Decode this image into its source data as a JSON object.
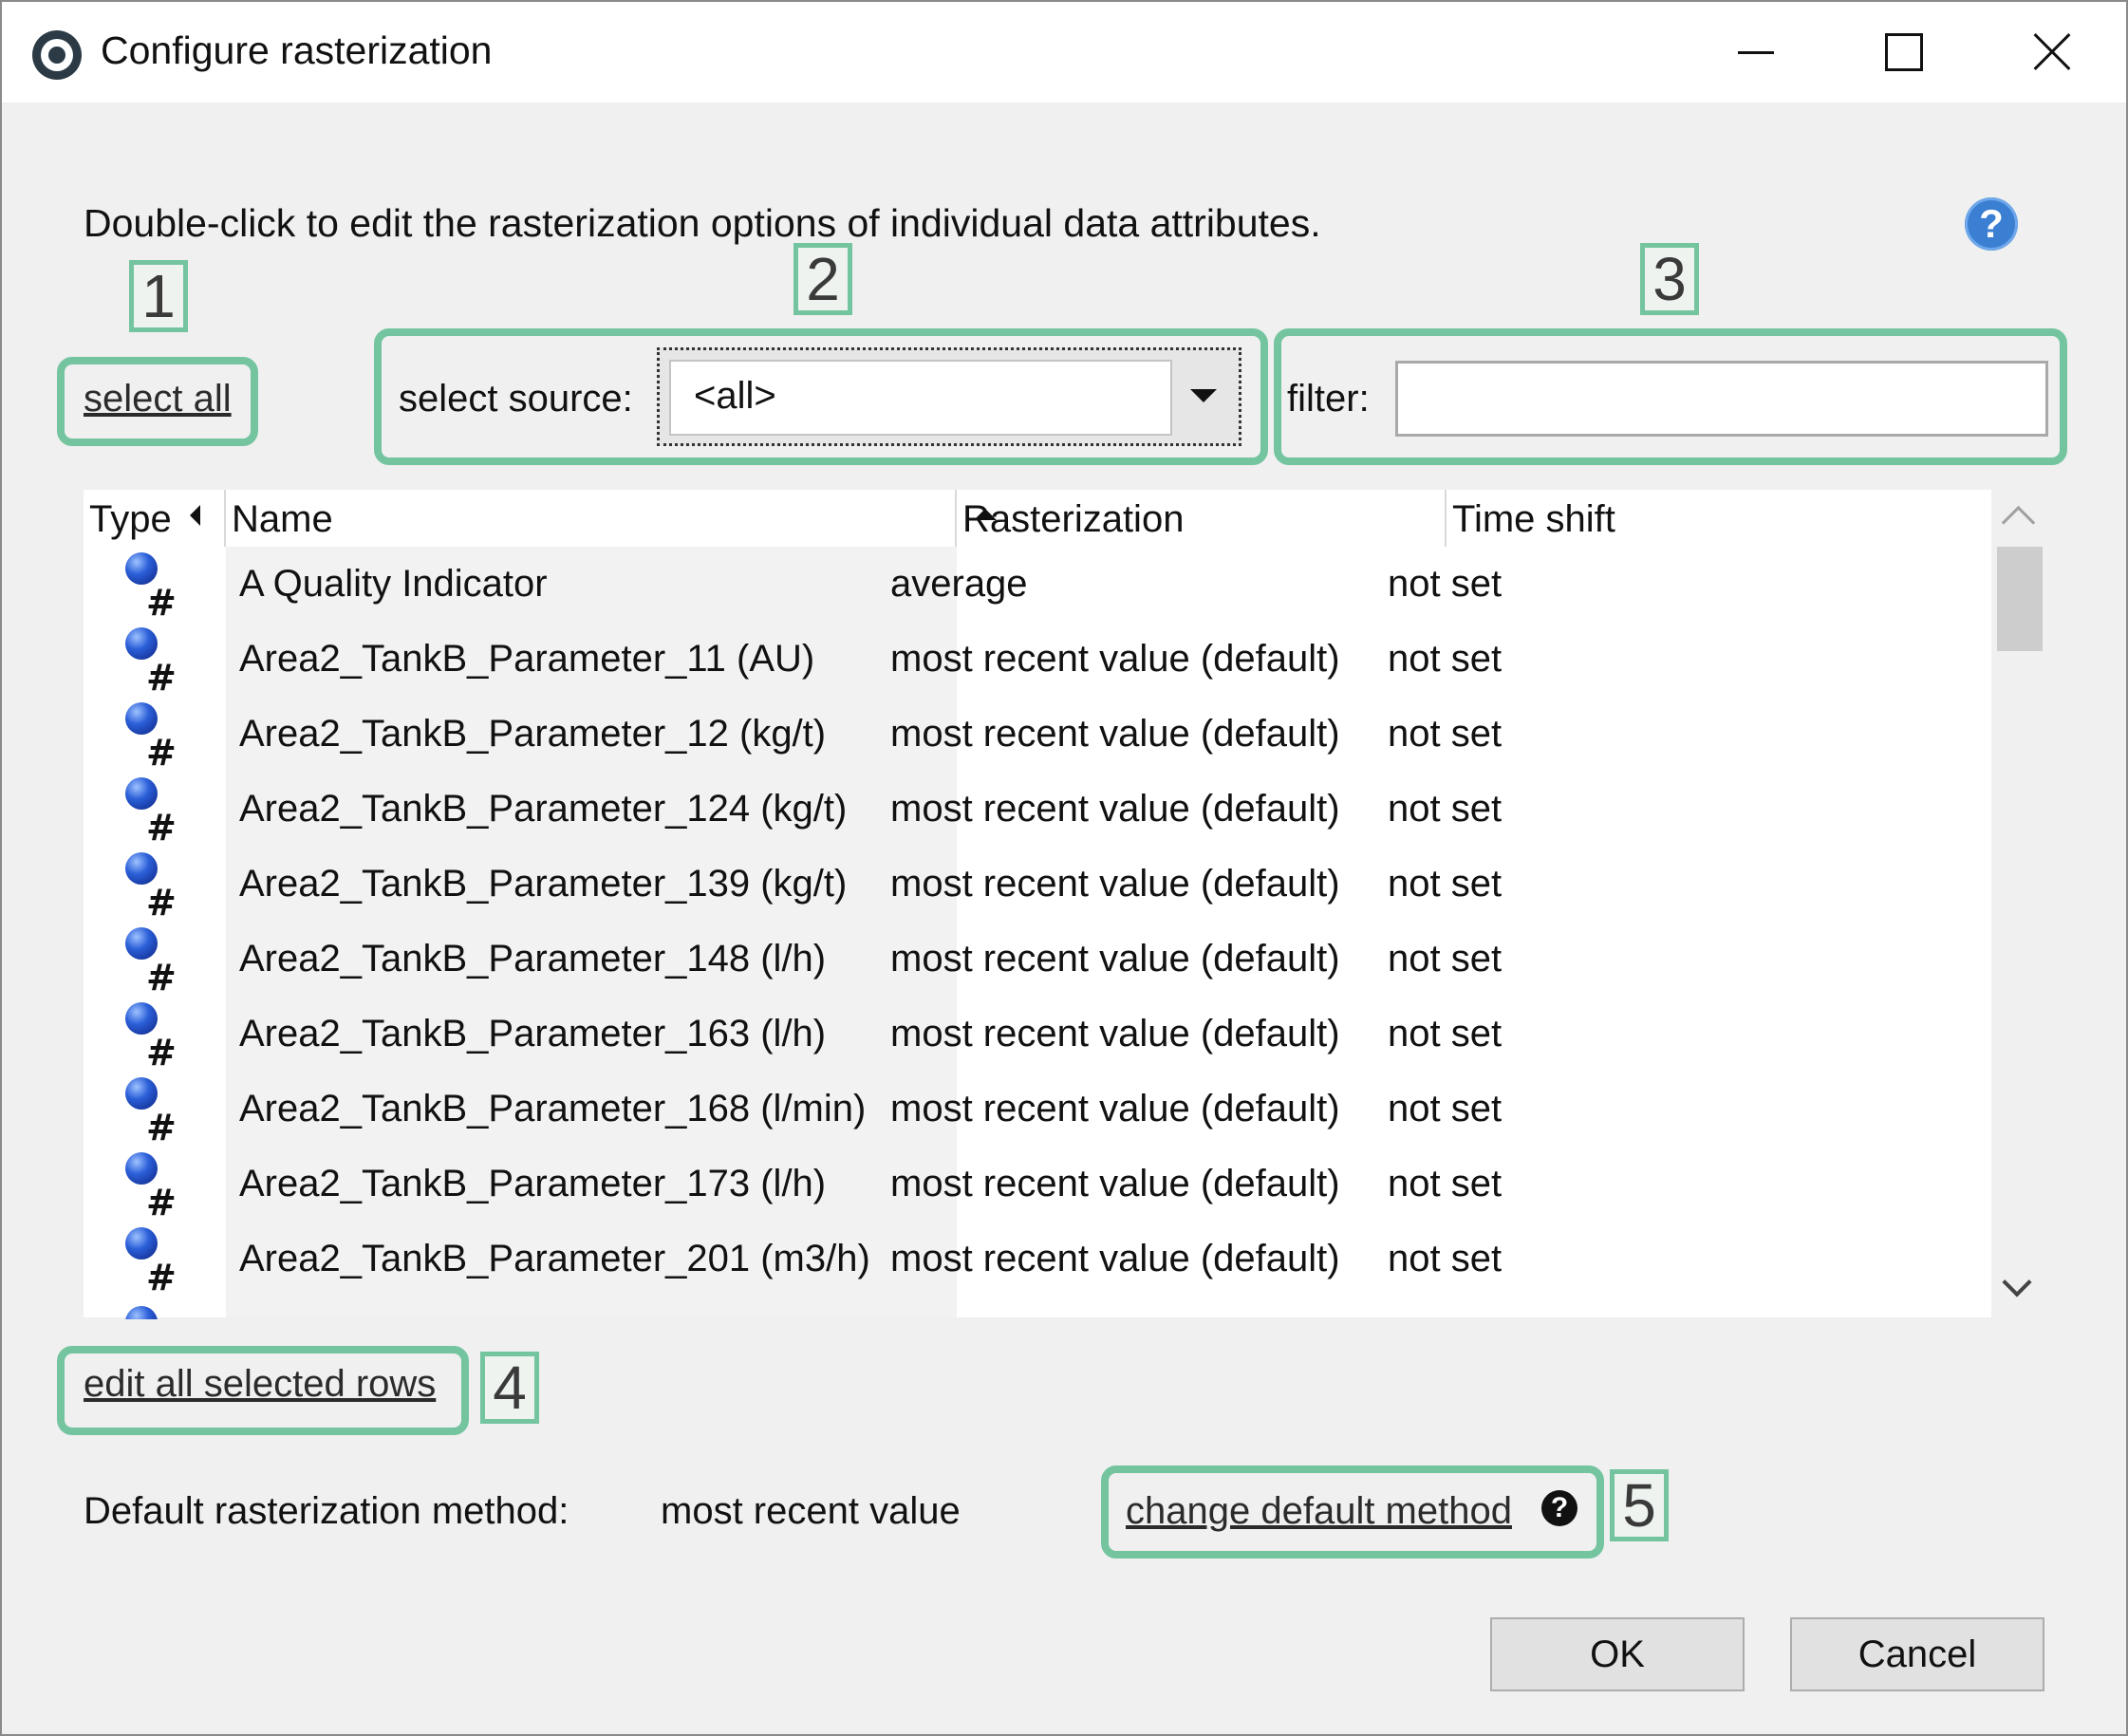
{
  "window": {
    "title": "Configure rasterization"
  },
  "instruction": "Double-click to edit the rasterization options of individual data attributes.",
  "help": {
    "symbol": "?"
  },
  "controls": {
    "select_all": "select all",
    "select_source_label": "select source:",
    "select_source_value": "<all>",
    "filter_label": "filter:",
    "filter_value": ""
  },
  "table": {
    "columns": [
      "Type",
      "Name",
      "Rasterization",
      "Time shift"
    ],
    "rows": [
      {
        "name": "A Quality Indicator",
        "rasterization": "average",
        "time_shift": "not set"
      },
      {
        "name": "Area2_TankB_Parameter_11 (AU)",
        "rasterization": "most recent value (default)",
        "time_shift": "not set"
      },
      {
        "name": "Area2_TankB_Parameter_12 (kg/t)",
        "rasterization": "most recent value (default)",
        "time_shift": "not set"
      },
      {
        "name": "Area2_TankB_Parameter_124 (kg/t)",
        "rasterization": "most recent value (default)",
        "time_shift": "not set"
      },
      {
        "name": "Area2_TankB_Parameter_139 (kg/t)",
        "rasterization": "most recent value (default)",
        "time_shift": "not set"
      },
      {
        "name": "Area2_TankB_Parameter_148 (l/h)",
        "rasterization": "most recent value (default)",
        "time_shift": "not set"
      },
      {
        "name": "Area2_TankB_Parameter_163 (l/h)",
        "rasterization": "most recent value (default)",
        "time_shift": "not set"
      },
      {
        "name": "Area2_TankB_Parameter_168 (l/min)",
        "rasterization": "most recent value (default)",
        "time_shift": "not set"
      },
      {
        "name": "Area2_TankB_Parameter_173 (l/h)",
        "rasterization": "most recent value (default)",
        "time_shift": "not set"
      },
      {
        "name": "Area2_TankB_Parameter_201 (m3/h)",
        "rasterization": "most recent value (default)",
        "time_shift": "not set"
      }
    ]
  },
  "edit_all_selected_rows": "edit all selected rows",
  "default_method": {
    "label": "Default rasterization method:",
    "value": "most recent value",
    "change_link": "change default method",
    "help_symbol": "?"
  },
  "buttons": {
    "ok": "OK",
    "cancel": "Cancel"
  },
  "callouts": [
    "1",
    "2",
    "3",
    "4",
    "5"
  ],
  "colors": {
    "callout_border": "#73c49f",
    "help_blue": "#3b7fd2",
    "type_ball_blue": "#2b5fd8"
  }
}
